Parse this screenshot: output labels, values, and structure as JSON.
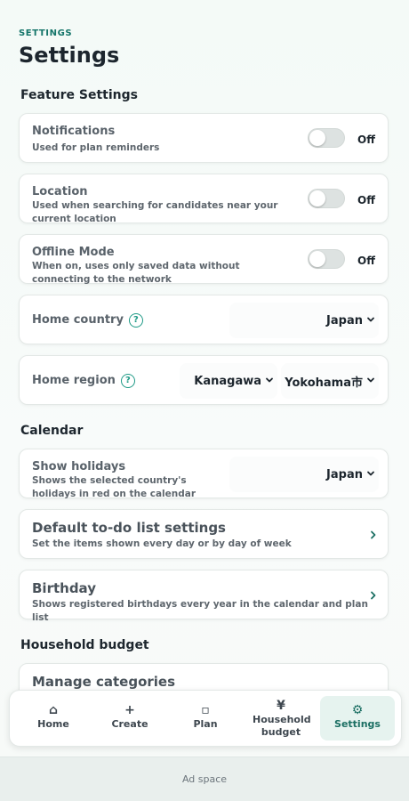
{
  "header": {
    "eyebrow": "SETTINGS",
    "title": "Settings"
  },
  "sections": {
    "feature": {
      "title": "Feature Settings",
      "notifications": {
        "title": "Notifications",
        "desc": "Used for plan reminders",
        "state": "Off"
      },
      "location": {
        "title": "Location",
        "desc": "Used when searching for candidates near your current location",
        "state": "Off"
      },
      "offline": {
        "title": "Offline Mode",
        "desc": "When on, uses only saved data without connecting to the network",
        "state": "Off"
      },
      "home_country": {
        "title": "Home country",
        "help": "?",
        "value": "Japan"
      },
      "home_region": {
        "title": "Home region",
        "help": "?",
        "prefecture": "Kanagawa",
        "city": "Yokohama市"
      }
    },
    "calendar": {
      "title": "Calendar",
      "holidays": {
        "title": "Show holidays",
        "desc": "Shows the selected country's holidays in red on the calendar",
        "value": "Japan"
      },
      "todo": {
        "title": "Default to-do list settings",
        "desc": "Set the items shown every day or by day of week"
      },
      "birthday": {
        "title": "Birthday",
        "desc": "Shows registered birthdays every year in the calendar and plan list"
      }
    },
    "budget": {
      "title": "Household budget",
      "categories": {
        "title": "Manage categories"
      }
    }
  },
  "nav": {
    "home": {
      "icon": "⌂",
      "label": "Home"
    },
    "create": {
      "icon": "+",
      "label": "Create"
    },
    "plan": {
      "icon": "▫",
      "label": "Plan"
    },
    "budget": {
      "icon": "¥",
      "label": "Household budget"
    },
    "settings": {
      "icon": "⚙",
      "label": "Settings"
    }
  },
  "ad": {
    "label": "Ad space"
  },
  "colors": {
    "accent": "#1b6f63",
    "accent_bg": "#e6f3ef",
    "help": "#1f9a86"
  }
}
